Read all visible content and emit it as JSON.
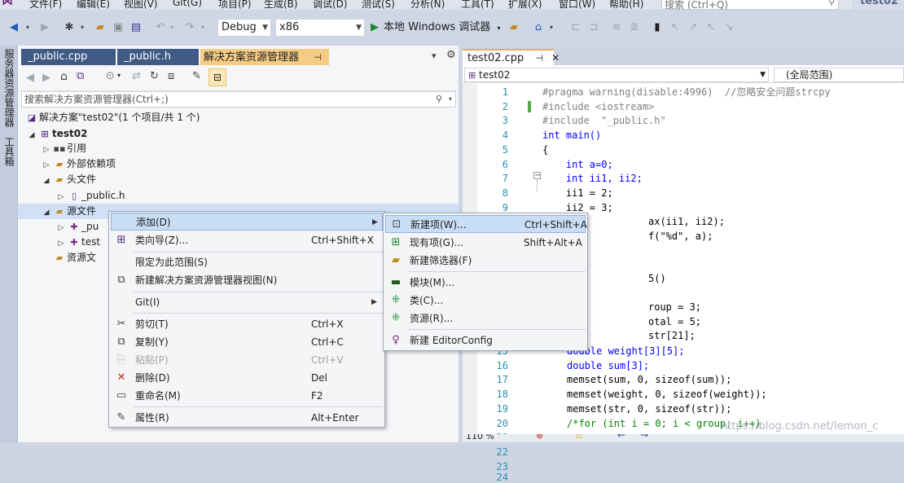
{
  "menubar": {
    "items": [
      "文件(F)",
      "编辑(E)",
      "视图(V)",
      "Git(G)",
      "项目(P)",
      "生成(B)",
      "调试(D)",
      "测试(S)",
      "分析(N)",
      "工具(T)",
      "扩展(X)",
      "窗口(W)",
      "帮助(H)"
    ],
    "search_placeholder": "搜索 (Ctrl+Q)",
    "window_title": "test02"
  },
  "toolbar": {
    "config": "Debug",
    "platform": "x86",
    "debugger": "本地 Windows 调试器"
  },
  "sidebar_tabs": [
    "服务器资源管理器",
    "工具箱"
  ],
  "solution_explorer": {
    "doc_tabs": [
      "_public.cpp",
      "_public.h",
      "解决方案资源管理器"
    ],
    "search_placeholder": "搜索解决方案资源管理器(Ctrl+;)",
    "tree": [
      {
        "text": "解决方案\"test02\"(1 个项目/共 1 个)",
        "level": 0
      },
      {
        "text": "test02",
        "level": 1
      },
      {
        "text": "引用",
        "level": 2
      },
      {
        "text": "外部依赖项",
        "level": 2
      },
      {
        "text": "头文件",
        "level": 2
      },
      {
        "text": "_public.h",
        "level": 3
      },
      {
        "text": "源文件",
        "level": 2
      },
      {
        "text": "_pu",
        "level": 3
      },
      {
        "text": "test",
        "level": 3
      },
      {
        "text": "资源文",
        "level": 2
      }
    ]
  },
  "context_menu": {
    "items": [
      {
        "label": "添加(D)",
        "shortcut": "",
        "submenu": true
      },
      {
        "label": "类向导(Z)...",
        "shortcut": "Ctrl+Shift+X"
      },
      {
        "label": "限定为此范围(S)",
        "shortcut": ""
      },
      {
        "label": "新建解决方案资源管理器视图(N)",
        "shortcut": ""
      },
      {
        "label": "Git(I)",
        "shortcut": "",
        "submenu": true
      },
      {
        "label": "剪切(T)",
        "shortcut": "Ctrl+X"
      },
      {
        "label": "复制(Y)",
        "shortcut": "Ctrl+C"
      },
      {
        "label": "粘贴(P)",
        "shortcut": "Ctrl+V"
      },
      {
        "label": "删除(D)",
        "shortcut": "Del"
      },
      {
        "label": "重命名(M)",
        "shortcut": "F2"
      },
      {
        "label": "属性(R)",
        "shortcut": "Alt+Enter"
      }
    ]
  },
  "add_submenu": {
    "items": [
      {
        "label": "新建项(W)...",
        "shortcut": "Ctrl+Shift+A"
      },
      {
        "label": "现有项(G)...",
        "shortcut": "Shift+Alt+A"
      },
      {
        "label": "新建筛选器(F)",
        "shortcut": ""
      },
      {
        "label": "模块(M)...",
        "shortcut": ""
      },
      {
        "label": "类(C)...",
        "shortcut": ""
      },
      {
        "label": "资源(R)...",
        "shortcut": ""
      },
      {
        "label": "新建 EditorConfig",
        "shortcut": ""
      }
    ]
  },
  "editor": {
    "tab": "test02.cpp",
    "nav_left": "test02",
    "nav_right": "(全局范围)",
    "zoom": "110 %",
    "lines": [
      "1",
      "2",
      "3",
      "4",
      "5",
      "6",
      "7",
      "8",
      "9",
      "15",
      "16",
      "17",
      "18",
      "19",
      "20",
      "21",
      "22",
      "23",
      "24"
    ],
    "code": {
      "l1": "#pragma warning(disable:4996)  //忽略安全问题strcpy",
      "l2": "#include <iostream>",
      "l3": "#include  \"_public.h\"",
      "l4": "int main()",
      "l5": "{",
      "l6": "    int a=0;",
      "l7": "    int ii1, ii2;",
      "l8": "    ii1 = 2;",
      "l9": "    ii2 = 3;",
      "l10": "ax(ii1, ii2);",
      "l11": "f(\"%d\", a);",
      "l12": "5()",
      "l13": "roup = 3;",
      "l14": "otal = 5;",
      "l15": "str[21];",
      "l16": "double weight[3][5];",
      "l17": "double sum[3];",
      "l18": "memset(sum, 0, sizeof(sum));",
      "l19": "memset(weight, 0, sizeof(weight));",
      "l20": "memset(str, 0, sizeof(str));",
      "l21": "/*for (int i = 0; i < group; i++)"
    }
  },
  "watermark": "https://blog.csdn.net/lemon_c"
}
